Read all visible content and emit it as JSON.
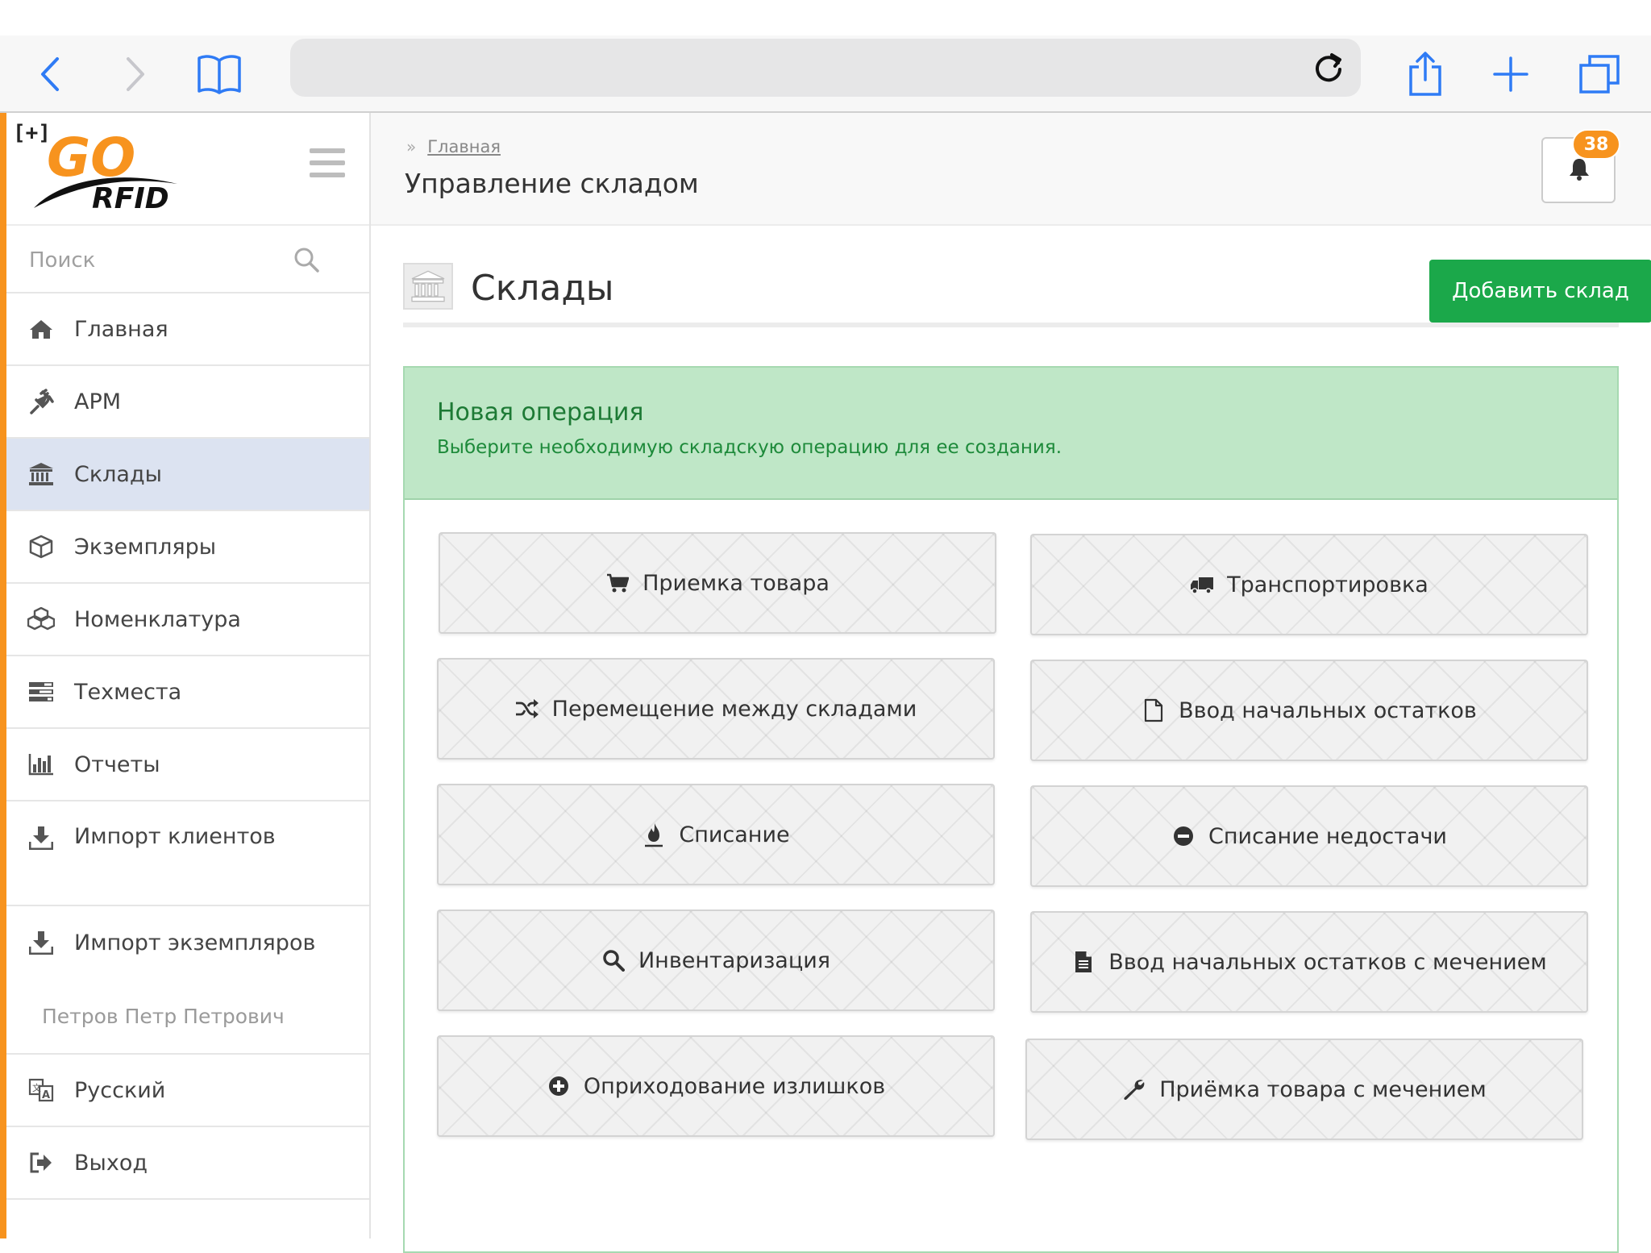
{
  "browser": {
    "url_value": ""
  },
  "logo": {
    "plus": "[+]",
    "go": "GO",
    "rfid": "RFID"
  },
  "sidebar": {
    "search_placeholder": "Поиск",
    "items": [
      {
        "label": "Главная",
        "icon": "home-icon"
      },
      {
        "label": "АРМ",
        "icon": "plug-icon"
      },
      {
        "label": "Склады",
        "icon": "bank-icon"
      },
      {
        "label": "Экземпляры",
        "icon": "cube-icon"
      },
      {
        "label": "Номенклатура",
        "icon": "cubes-icon"
      },
      {
        "label": "Техместа",
        "icon": "tasks-icon"
      },
      {
        "label": "Отчеты",
        "icon": "bar-chart-icon"
      },
      {
        "label": "Импорт клиентов",
        "icon": "download-icon"
      },
      {
        "label": "Импорт экземпляров",
        "icon": "download-icon"
      }
    ],
    "user_name": "Петров Петр Петрович",
    "bottom_items": [
      {
        "label": "Русский",
        "icon": "language-icon"
      },
      {
        "label": "Выход",
        "icon": "sign-out-icon"
      }
    ]
  },
  "header": {
    "breadcrumb": "Главная",
    "title": "Управление складом",
    "notifications_count": "38"
  },
  "section": {
    "title": "Склады",
    "add_button": "Добавить склад"
  },
  "panel": {
    "title": "Новая операция",
    "subtitle": "Выберите необходимую складскую операцию для ее создания.",
    "operations": [
      {
        "label": "Приемка товара",
        "icon": "cart-icon"
      },
      {
        "label": "Транспортировка",
        "icon": "truck-icon"
      },
      {
        "label": "Перемещение между складами",
        "icon": "shuffle-icon"
      },
      {
        "label": "Ввод начальных остатков",
        "icon": "file-outline-icon"
      },
      {
        "label": "Списание",
        "icon": "fire-icon"
      },
      {
        "label": "Списание недостачи",
        "icon": "minus-circle-icon"
      },
      {
        "label": "Инвентаризация",
        "icon": "search-icon"
      },
      {
        "label": "Ввод начальных остатков с мечением",
        "icon": "file-text-icon"
      },
      {
        "label": "Оприходование излишков",
        "icon": "plus-circle-icon"
      },
      {
        "label": "Приёмка товара с мечением",
        "icon": "wrench-icon"
      }
    ]
  },
  "colors": {
    "accent_orange": "#f7931e",
    "success_green": "#1ba84a",
    "panel_green": "#bfe7c7",
    "ios_blue": "#2f7bf5",
    "active_nav": "#dce3f1"
  }
}
